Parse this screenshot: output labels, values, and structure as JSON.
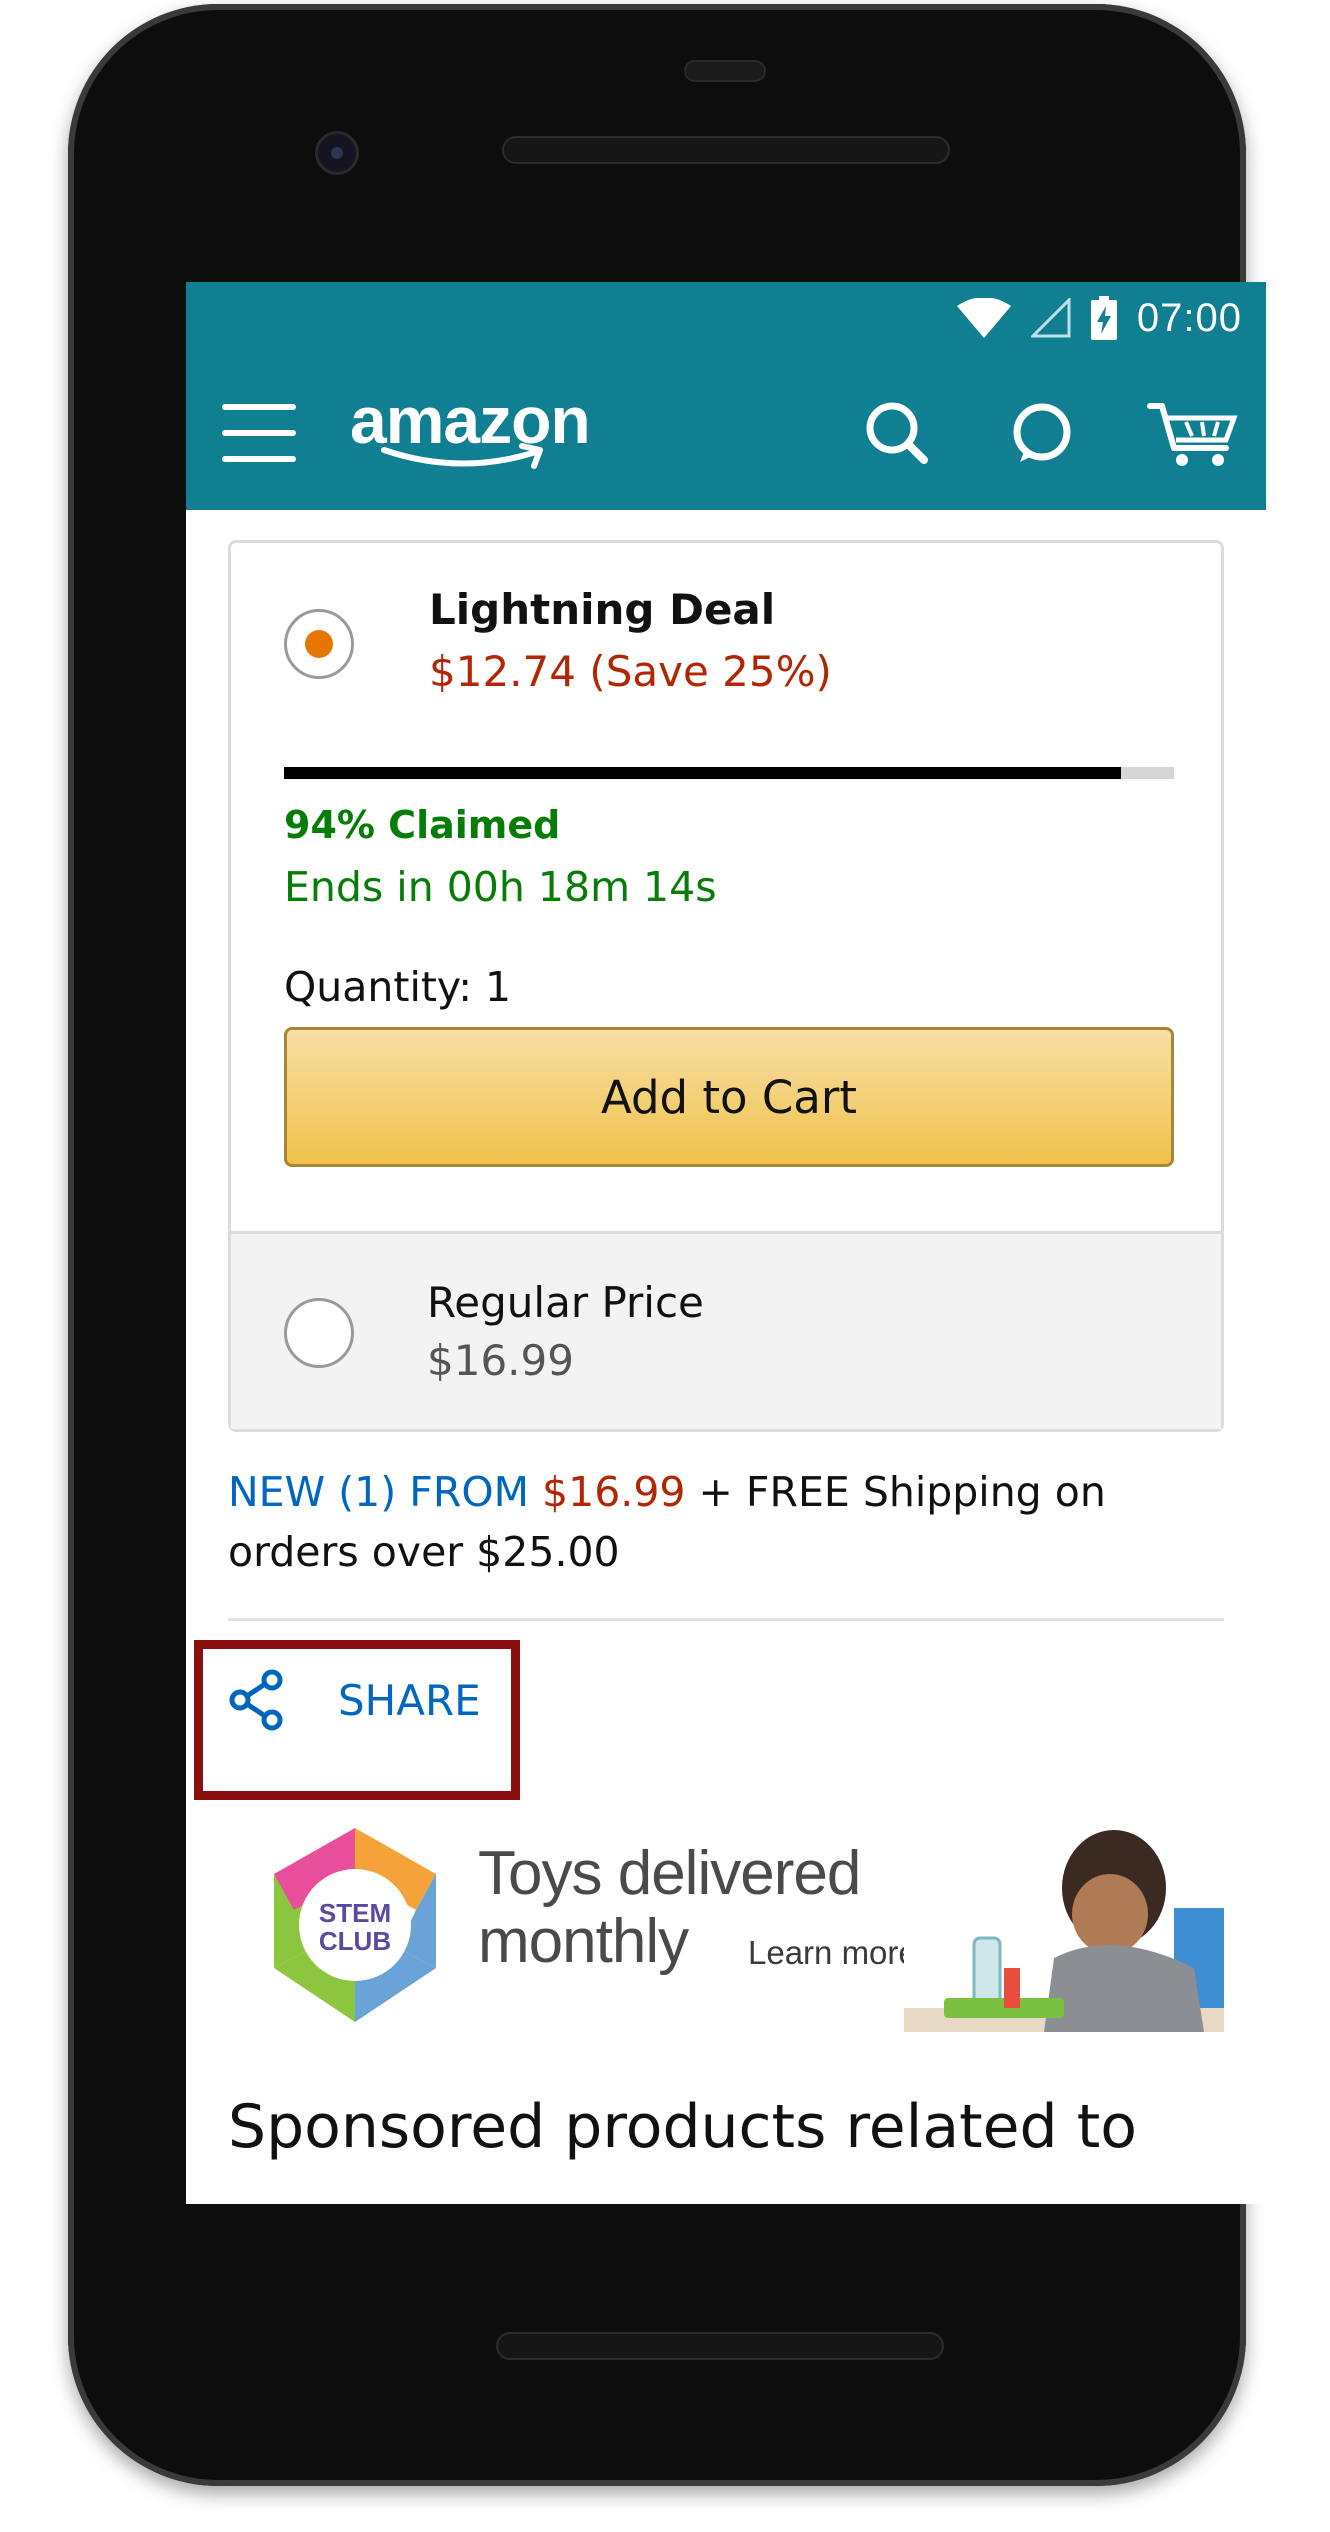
{
  "status_bar": {
    "time": "07:00",
    "icons": [
      "wifi-icon",
      "signal-icon",
      "battery-charging-icon"
    ]
  },
  "app_bar": {
    "logo_text": "amazon",
    "icons": [
      "menu-icon",
      "search-icon",
      "alexa-icon",
      "cart-icon"
    ]
  },
  "lightning_deal": {
    "title": "Lightning Deal",
    "price": "$12.74 (Save 25%)",
    "claimed_percent": 94,
    "claimed_label": "94% Claimed",
    "ends_label": "Ends in 00h 18m 14s",
    "quantity_label": "Quantity: 1",
    "add_to_cart_label": "Add to Cart",
    "selected": true
  },
  "regular_price": {
    "title": "Regular Price",
    "price": "$16.99",
    "selected": false
  },
  "offer": {
    "new_from": "NEW (1) FROM",
    "price": "$16.99",
    "shipping_line1": "+ FREE Shipping on",
    "shipping_line2": "orders over $25.00"
  },
  "share": {
    "label": "SHARE"
  },
  "banner": {
    "badge_line1": "STEM",
    "badge_line2": "CLUB",
    "headline_line1": "Toys delivered",
    "headline_line2": "monthly",
    "learn_more": "Learn more ›"
  },
  "sponsored": {
    "heading": "Sponsored products related to"
  },
  "colors": {
    "header": "#0f7f91",
    "deal_price": "#b12704",
    "claimed_green": "#067d06",
    "link_blue": "#0066c0",
    "radio_selected": "#e77600",
    "cart_button": "#f0c14b",
    "highlight_border": "#8b0f0f"
  }
}
